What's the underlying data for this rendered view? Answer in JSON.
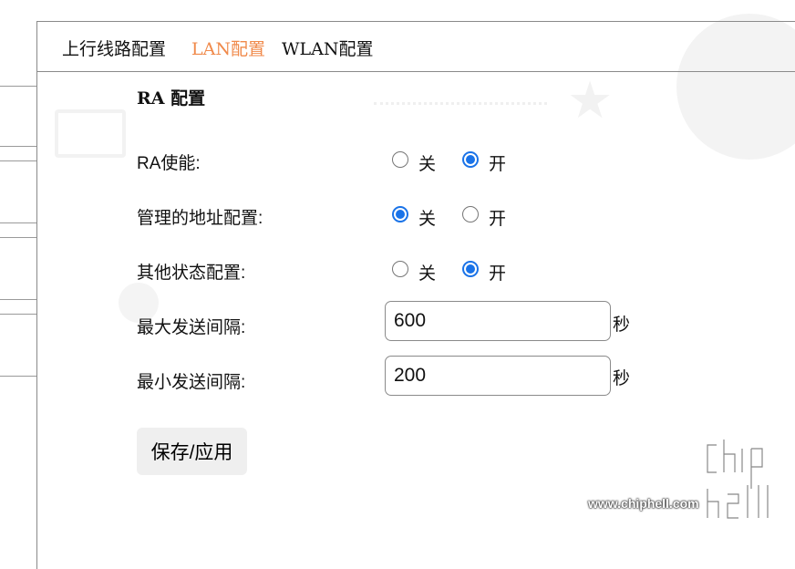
{
  "tabs": [
    {
      "label": "上行线路配置",
      "active": false
    },
    {
      "label": "LAN配置",
      "active": true
    },
    {
      "label": "WLAN配置",
      "active": false
    }
  ],
  "section_title": "RA 配置",
  "rows": {
    "ra_enable": {
      "label": "RA使能:",
      "off_label": "关",
      "on_label": "开",
      "selected": "on"
    },
    "managed_config": {
      "label": "管理的地址配置:",
      "off_label": "关",
      "on_label": "开",
      "selected": "off"
    },
    "other_config": {
      "label": "其他状态配置:",
      "off_label": "关",
      "on_label": "开",
      "selected": "on"
    },
    "max_interval": {
      "label": "最大发送间隔:",
      "value": "600",
      "unit": "秒"
    },
    "min_interval": {
      "label": "最小发送间隔:",
      "value": "200",
      "unit": "秒"
    }
  },
  "save_button": "保存/应用",
  "watermark": {
    "url": "www.chiphell.com",
    "logo_text": "chip hell"
  },
  "colors": {
    "accent": "#f08a4b",
    "radio": "#1a73e8",
    "button_bg": "#efefef"
  }
}
